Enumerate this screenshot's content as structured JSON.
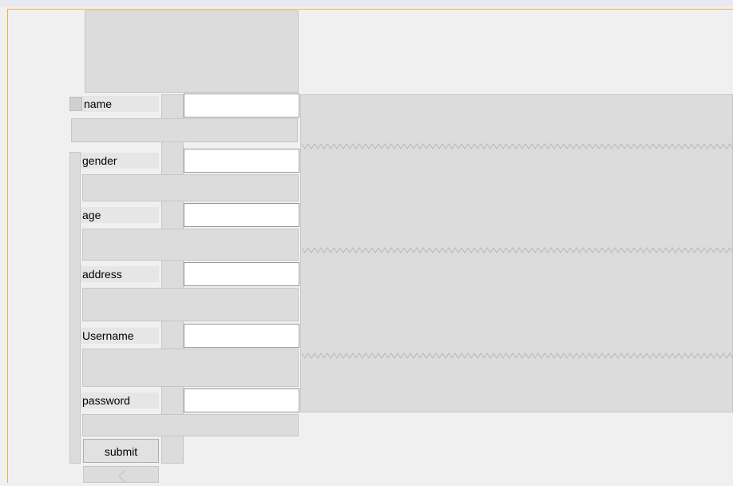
{
  "form": {
    "fields": [
      {
        "label": "name",
        "value": ""
      },
      {
        "label": "gender",
        "value": ""
      },
      {
        "label": "age",
        "value": ""
      },
      {
        "label": "address",
        "value": ""
      },
      {
        "label": "Username",
        "value": ""
      },
      {
        "label": "password",
        "value": ""
      }
    ],
    "submit_label": "submit"
  },
  "colors": {
    "background": "#f0f0f0",
    "panel": "#dcdcdc",
    "frame_accent": "#f1b04c",
    "input_background": "#ffffff"
  },
  "icons": {
    "zigzag": "zigzag-divider-icon",
    "chevron": "chevron-left-icon"
  }
}
